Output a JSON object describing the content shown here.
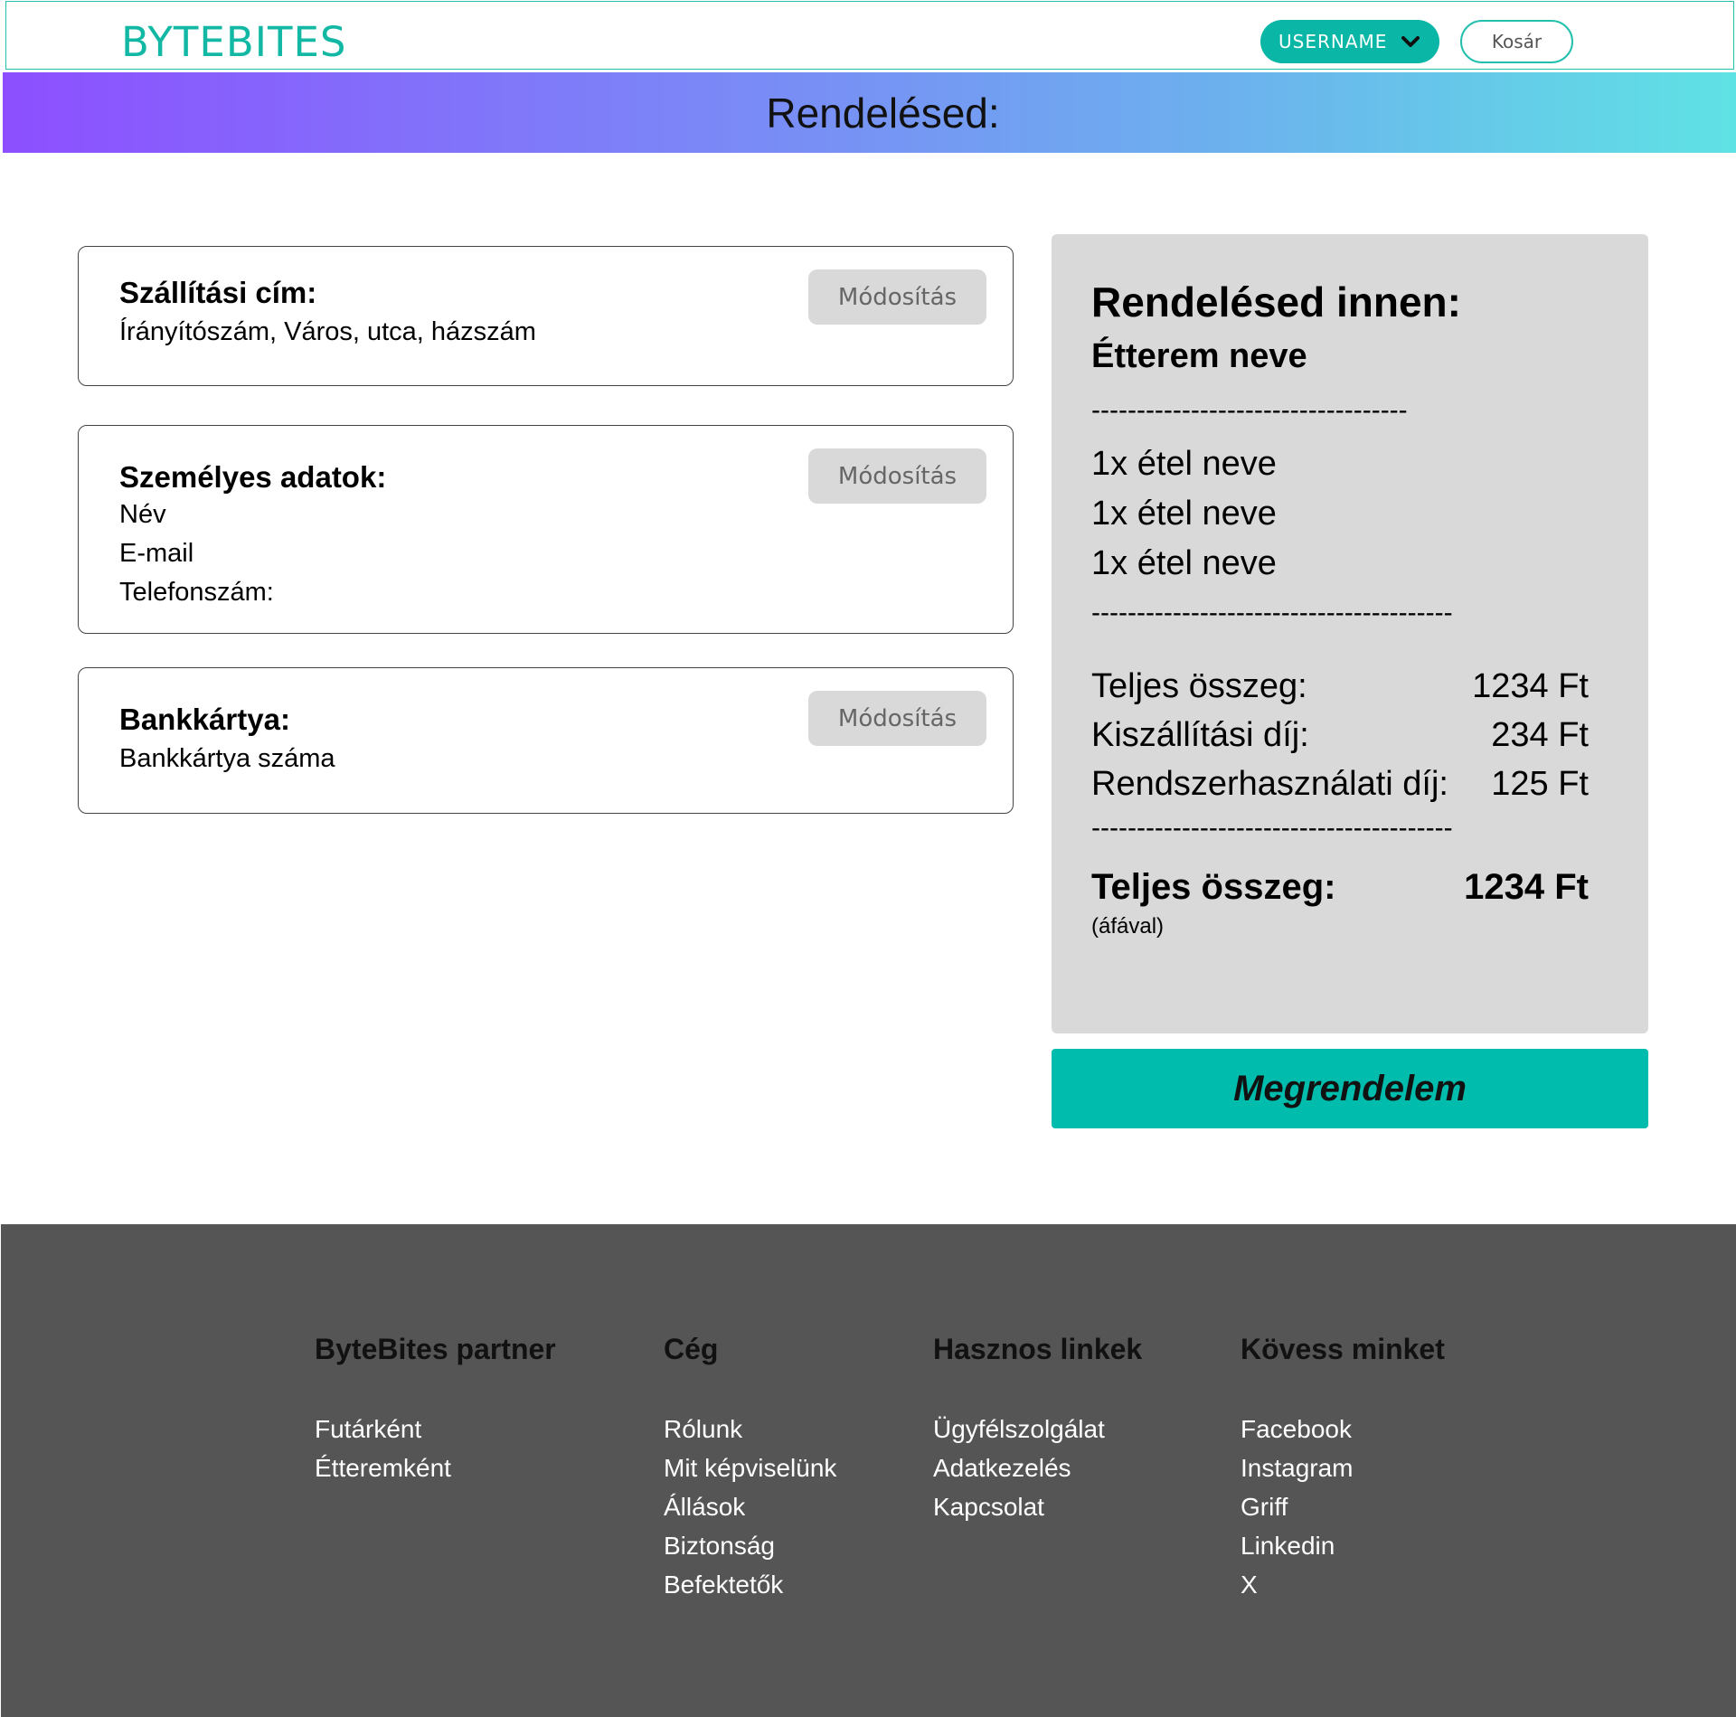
{
  "header": {
    "logo": "BYTEBITES",
    "user_label": "USERNAME",
    "cart_label": "Kosár"
  },
  "banner": {
    "title": "Rendelésed:"
  },
  "shipping": {
    "title": "Szállítási cím:",
    "line": "Írányítószám, Város, utca, házszám",
    "modify_label": "Módosítás"
  },
  "personal": {
    "title": "Személyes adatok:",
    "lines": [
      "Név",
      "E-mail",
      "Telefonszám:"
    ],
    "modify_label": "Módosítás"
  },
  "card": {
    "title": "Bankkártya:",
    "line": "Bankkártya száma",
    "modify_label": "Módosítás"
  },
  "summary": {
    "title": "Rendelésed innen:",
    "restaurant": "Étterem neve",
    "divider1": "-----------------------------------",
    "items": [
      "1x étel neve",
      "1x étel neve",
      "1x étel neve"
    ],
    "divider2": "----------------------------------------",
    "rows": [
      {
        "label": "Teljes összeg:",
        "amount": "1234 Ft"
      },
      {
        "label": "Kiszállítási díj:",
        "amount": "234 Ft"
      },
      {
        "label": "Rendszerhasználati díj:",
        "amount": "125 Ft"
      }
    ],
    "divider3": "----------------------------------------",
    "total_label": "Teljes összeg:",
    "total_amount": "1234 Ft",
    "vat_note": "(áfával)"
  },
  "order_button": "Megrendelem",
  "footer": {
    "columns": [
      {
        "heading": "ByteBites partner",
        "links": [
          "Futárként",
          "Étteremként"
        ]
      },
      {
        "heading": "Cég",
        "links": [
          "Rólunk",
          "Mit képviselünk",
          "Állások",
          "Biztonság",
          "Befektetők"
        ]
      },
      {
        "heading": "Hasznos linkek",
        "links": [
          "Ügyfélszolgálat",
          "Adatkezelés",
          "Kapcsolat"
        ]
      },
      {
        "heading": "Kövess minket",
        "links": [
          "Facebook",
          "Instagram",
          "Griff",
          "Linkedin",
          "X"
        ]
      }
    ]
  },
  "colors": {
    "accent": "#0ab7a6",
    "banner_start": "#8d4fff",
    "banner_end": "#5fe2e4",
    "summary_bg": "#d9d9d9",
    "footer_bg": "#555555"
  }
}
